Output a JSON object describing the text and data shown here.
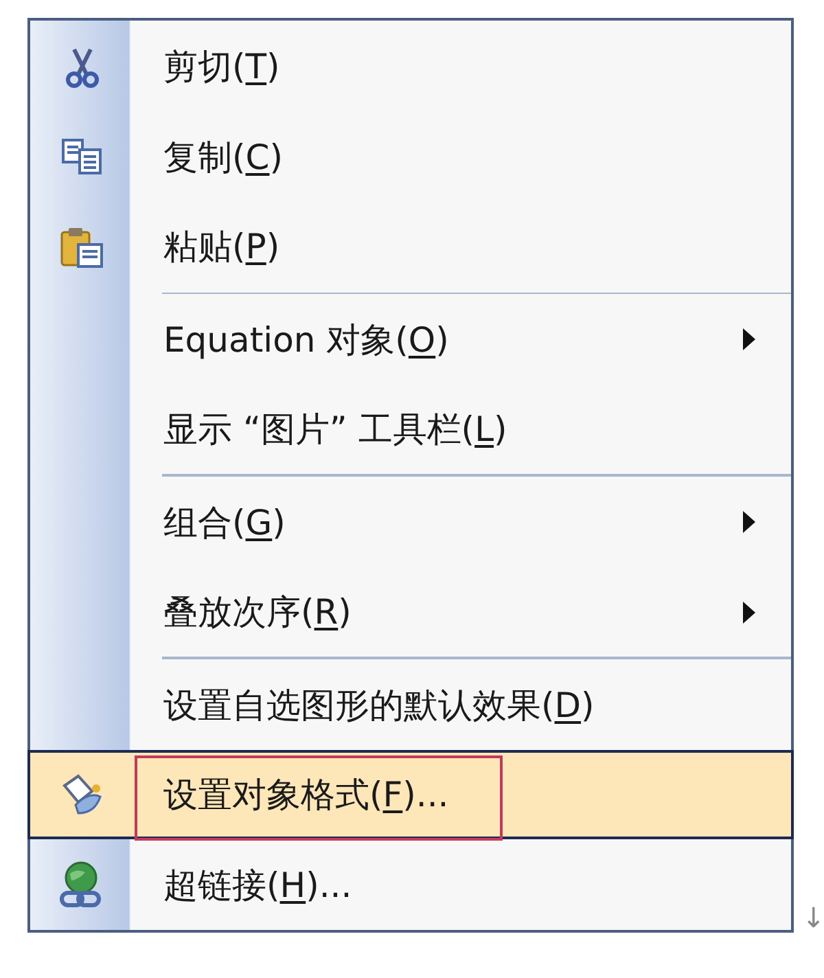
{
  "menu": {
    "items": [
      {
        "kind": "item",
        "label": "剪切(T)",
        "submenu": false,
        "selected": false,
        "annotated": false
      },
      {
        "kind": "item",
        "label": "复制(C)",
        "submenu": false,
        "selected": false,
        "annotated": false
      },
      {
        "kind": "item",
        "label": "粘贴(P)",
        "submenu": false,
        "selected": false,
        "annotated": false
      },
      {
        "kind": "separator"
      },
      {
        "kind": "item",
        "label": "Equation 对象(O)",
        "submenu": true,
        "selected": false,
        "annotated": false
      },
      {
        "kind": "item",
        "label": "显示 “图片” 工具栏(L)",
        "submenu": false,
        "selected": false,
        "annotated": false
      },
      {
        "kind": "separator"
      },
      {
        "kind": "item",
        "label": "组合(G)",
        "submenu": true,
        "selected": false,
        "annotated": false
      },
      {
        "kind": "item",
        "label": "叠放次序(R)",
        "submenu": true,
        "selected": false,
        "annotated": false
      },
      {
        "kind": "separator"
      },
      {
        "kind": "item",
        "label": "设置自选图形的默认效果(D)",
        "submenu": false,
        "selected": false,
        "annotated": false
      },
      {
        "kind": "item",
        "label": "设置对象格式(F)...",
        "submenu": false,
        "selected": true,
        "annotated": true
      },
      {
        "kind": "item",
        "label": "超链接(H)...",
        "submenu": false,
        "selected": false,
        "annotated": false
      }
    ]
  },
  "corner_mark": "↓"
}
